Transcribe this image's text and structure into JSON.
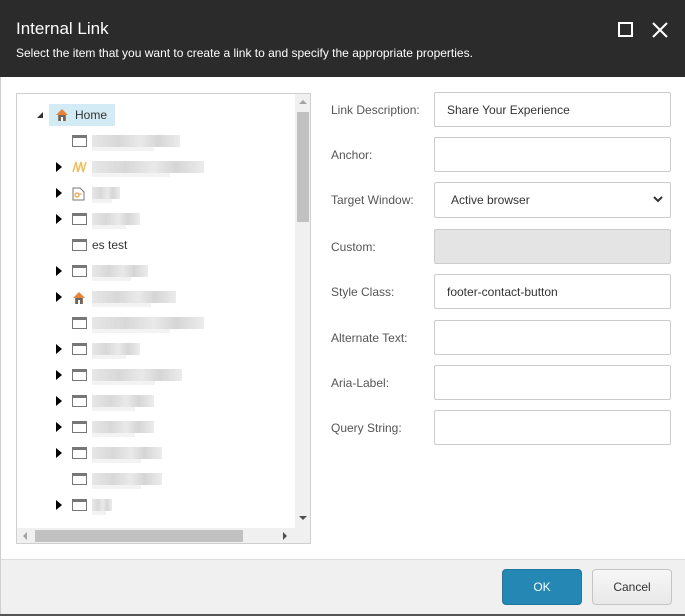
{
  "dialog": {
    "title": "Internal Link",
    "subtitle": "Select the item that you want to create a link to and specify the appropriate properties.",
    "maximize_icon": "maximize-icon",
    "close_icon": "close-icon"
  },
  "tree": {
    "root": {
      "label": "Home",
      "icon": "home-icon",
      "expanded": true,
      "selected": true
    },
    "items": [
      {
        "label": "",
        "icon": "page-icon",
        "has_children": false,
        "blurred": true
      },
      {
        "label": "",
        "icon": "wave-icon",
        "has_children": true,
        "blurred": true
      },
      {
        "label": "",
        "icon": "link-document-icon",
        "has_children": true,
        "blurred": true
      },
      {
        "label": "",
        "icon": "page-icon",
        "has_children": true,
        "blurred": true
      },
      {
        "label": "es test",
        "icon": "page-icon",
        "has_children": false,
        "blurred": false
      },
      {
        "label": "",
        "icon": "page-icon",
        "has_children": true,
        "blurred": true
      },
      {
        "label": "",
        "icon": "home-icon",
        "has_children": true,
        "blurred": true
      },
      {
        "label": "",
        "icon": "page-icon",
        "has_children": false,
        "blurred": true
      },
      {
        "label": "",
        "icon": "page-icon",
        "has_children": true,
        "blurred": true
      },
      {
        "label": "",
        "icon": "page-icon",
        "has_children": true,
        "blurred": true
      },
      {
        "label": "",
        "icon": "page-icon",
        "has_children": true,
        "blurred": true
      },
      {
        "label": "",
        "icon": "page-icon",
        "has_children": true,
        "blurred": true
      },
      {
        "label": "",
        "icon": "page-icon",
        "has_children": true,
        "blurred": true
      },
      {
        "label": "",
        "icon": "page-icon",
        "has_children": false,
        "blurred": true
      },
      {
        "label": "",
        "icon": "page-icon",
        "has_children": true,
        "blurred": true
      }
    ]
  },
  "form": {
    "link_description": {
      "label": "Link Description:",
      "value": "Share Your Experience"
    },
    "anchor": {
      "label": "Anchor:",
      "value": ""
    },
    "target_window": {
      "label": "Target Window:",
      "value": "Active browser"
    },
    "custom": {
      "label": "Custom:",
      "value": ""
    },
    "style_class": {
      "label": "Style Class:",
      "value": "footer-contact-button"
    },
    "alternate_text": {
      "label": "Alternate Text:",
      "value": ""
    },
    "aria_label": {
      "label": "Aria-Label:",
      "value": ""
    },
    "query_string": {
      "label": "Query String:",
      "value": ""
    }
  },
  "buttons": {
    "ok": "OK",
    "cancel": "Cancel"
  },
  "colors": {
    "header_bg": "#2b2b2b",
    "ok_button": "#2487b4",
    "selected_node": "#d2ebf5",
    "home_icon": "#e8833a"
  }
}
